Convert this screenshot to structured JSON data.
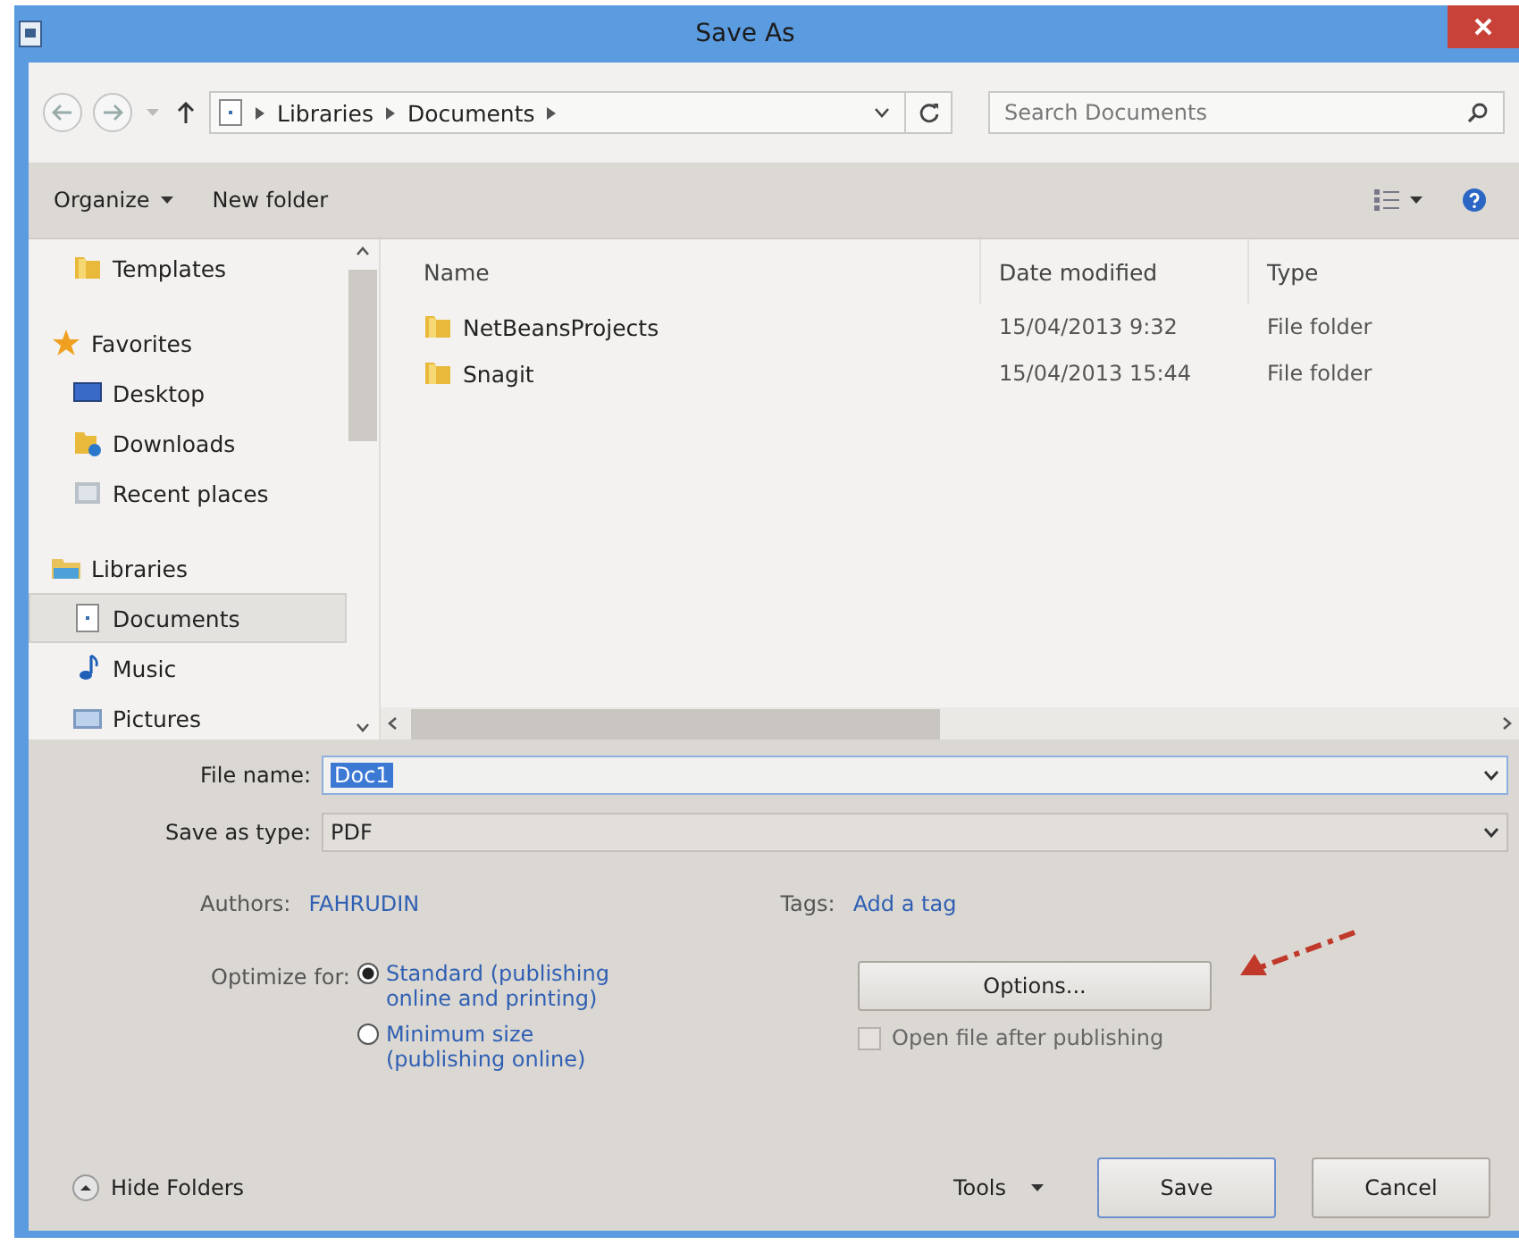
{
  "window": {
    "title": "Save As"
  },
  "navigation": {
    "breadcrumb": [
      {
        "label": "Libraries"
      },
      {
        "label": "Documents"
      }
    ],
    "search": {
      "placeholder": "Search Documents"
    }
  },
  "toolbar": {
    "buttons": [
      {
        "label": "Organize",
        "dropdown": true
      },
      {
        "label": "New folder",
        "dropdown": false
      }
    ]
  },
  "sidebar": {
    "items": [
      {
        "children": [
          {
            "label": "Templates",
            "kind": "folder",
            "selected": false
          }
        ]
      },
      {
        "label": "Favorites",
        "kind": "star",
        "selected": false,
        "children": [
          {
            "label": "Desktop",
            "kind": "desktop",
            "selected": false
          },
          {
            "label": "Downloads",
            "kind": "downloads",
            "selected": false
          },
          {
            "label": "Recent places",
            "kind": "recent",
            "selected": false
          }
        ]
      },
      {
        "label": "Libraries",
        "kind": "libraries",
        "selected": false,
        "children": [
          {
            "label": "Documents",
            "kind": "document",
            "selected": true
          },
          {
            "label": "Music",
            "kind": "music",
            "selected": false
          },
          {
            "label": "Pictures",
            "kind": "pictures",
            "selected": false
          }
        ]
      }
    ]
  },
  "file_list": {
    "columns": [
      "Name",
      "Date modified",
      "Type"
    ],
    "rows": [
      {
        "name": "NetBeansProjects",
        "date_modified": "15/04/2013 9:32",
        "type": "File folder"
      },
      {
        "name": "Snagit",
        "date_modified": "15/04/2013 15:44",
        "type": "File folder"
      }
    ]
  },
  "form": {
    "file_name": {
      "label": "File name:",
      "value": "Doc1"
    },
    "save_as_type": {
      "label": "Save as type:",
      "value": "PDF"
    },
    "authors": {
      "label": "Authors:",
      "value": "FAHRUDIN"
    },
    "tags": {
      "label": "Tags:",
      "value": "Add a tag"
    },
    "optimize": {
      "label": "Optimize for:",
      "options": [
        {
          "label": "Standard (publishing online and printing)",
          "selected": true
        },
        {
          "label": "Minimum size (publishing online)",
          "selected": false
        }
      ]
    },
    "options_button": "Options...",
    "open_after": {
      "label": "Open file after publishing",
      "checked": false,
      "disabled": true
    }
  },
  "footer": {
    "hide_folders": "Hide Folders",
    "tools": "Tools",
    "buttons": [
      {
        "label": "Save",
        "default": true
      },
      {
        "label": "Cancel",
        "default": false
      }
    ]
  }
}
